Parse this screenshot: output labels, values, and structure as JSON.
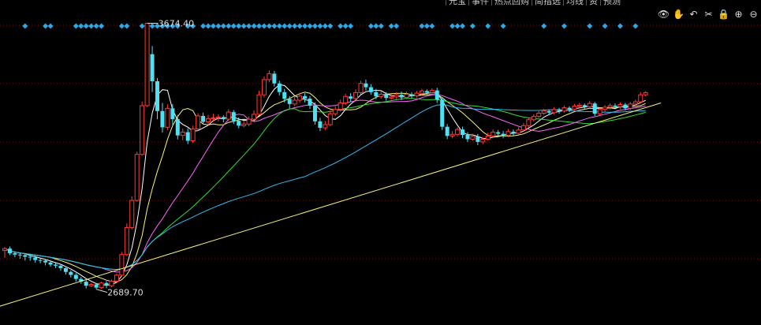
{
  "toolbar": {
    "tabs": [
      "元宝",
      "事件",
      "热点回购",
      "简指选",
      "均线",
      "资",
      "预测"
    ],
    "tools": [
      {
        "name": "eye-icon",
        "glyph": "👁"
      },
      {
        "name": "hand-icon",
        "glyph": "✋"
      },
      {
        "name": "undo-icon",
        "glyph": "↶"
      },
      {
        "name": "scissors-icon",
        "glyph": "✂"
      },
      {
        "name": "lock-icon",
        "glyph": "🔒"
      },
      {
        "name": "zoom-in-icon",
        "glyph": "⊕"
      },
      {
        "name": "zoom-out-icon",
        "glyph": "⊖"
      }
    ]
  },
  "chart_data": {
    "type": "candlestick",
    "ylim": [
      2560,
      3760
    ],
    "high_label": "3674.40",
    "low_label": "2689.70",
    "colors": {
      "up": "#ff3a3a",
      "down": "#4de1f5",
      "ma5": "#ffffff",
      "ma10": "#f5f57a",
      "ma20": "#ff66ff",
      "ma30": "#33dd33",
      "ma60": "#33bbee",
      "trend": "#f5f57a",
      "grid": "#7a1010",
      "marker": "#2aa9e8"
    },
    "candles": [
      [
        2835,
        2842,
        2808,
        2848
      ],
      [
        2842,
        2825,
        2818,
        2850
      ],
      [
        2825,
        2820,
        2810,
        2832
      ],
      [
        2820,
        2818,
        2805,
        2828
      ],
      [
        2818,
        2812,
        2798,
        2826
      ],
      [
        2812,
        2809,
        2797,
        2820
      ],
      [
        2809,
        2800,
        2790,
        2816
      ],
      [
        2800,
        2798,
        2788,
        2806
      ],
      [
        2798,
        2791,
        2780,
        2803
      ],
      [
        2791,
        2783,
        2775,
        2798
      ],
      [
        2783,
        2779,
        2770,
        2790
      ],
      [
        2779,
        2770,
        2760,
        2785
      ],
      [
        2770,
        2756,
        2746,
        2776
      ],
      [
        2756,
        2745,
        2735,
        2762
      ],
      [
        2745,
        2730,
        2720,
        2752
      ],
      [
        2730,
        2720,
        2712,
        2738
      ],
      [
        2720,
        2705,
        2695,
        2726
      ],
      [
        2705,
        2710,
        2700,
        2716
      ],
      [
        2710,
        2698,
        2692,
        2714
      ],
      [
        2698,
        2715,
        2693,
        2720
      ],
      [
        2715,
        2705,
        2696,
        2722
      ],
      [
        2705,
        2722,
        2700,
        2728
      ],
      [
        2722,
        2744,
        2715,
        2750
      ],
      [
        2744,
        2820,
        2740,
        2830
      ],
      [
        2820,
        2920,
        2815,
        2935
      ],
      [
        2920,
        3020,
        2912,
        3035
      ],
      [
        3020,
        3190,
        3015,
        3200
      ],
      [
        3190,
        3370,
        3185,
        3385
      ],
      [
        3370,
        3674,
        3365,
        3674
      ],
      [
        3560,
        3460,
        3420,
        3590
      ],
      [
        3460,
        3350,
        3320,
        3472
      ],
      [
        3350,
        3290,
        3270,
        3380
      ],
      [
        3290,
        3360,
        3280,
        3375
      ],
      [
        3360,
        3320,
        3300,
        3376
      ],
      [
        3320,
        3260,
        3245,
        3336
      ],
      [
        3260,
        3272,
        3242,
        3285
      ],
      [
        3272,
        3240,
        3228,
        3286
      ],
      [
        3240,
        3284,
        3232,
        3296
      ],
      [
        3284,
        3332,
        3278,
        3342
      ],
      [
        3332,
        3310,
        3300,
        3344
      ],
      [
        3310,
        3322,
        3298,
        3336
      ],
      [
        3322,
        3325,
        3310,
        3340
      ],
      [
        3325,
        3328,
        3312,
        3338
      ],
      [
        3328,
        3320,
        3308,
        3334
      ],
      [
        3320,
        3346,
        3314,
        3356
      ],
      [
        3346,
        3314,
        3302,
        3354
      ],
      [
        3314,
        3296,
        3286,
        3326
      ],
      [
        3296,
        3302,
        3290,
        3314
      ],
      [
        3302,
        3320,
        3294,
        3330
      ],
      [
        3320,
        3338,
        3314,
        3352
      ],
      [
        3338,
        3410,
        3334,
        3425
      ],
      [
        3410,
        3466,
        3400,
        3478
      ],
      [
        3466,
        3488,
        3456,
        3500
      ],
      [
        3488,
        3452,
        3440,
        3498
      ],
      [
        3452,
        3420,
        3408,
        3462
      ],
      [
        3420,
        3395,
        3382,
        3432
      ],
      [
        3395,
        3376,
        3360,
        3405
      ],
      [
        3376,
        3390,
        3368,
        3402
      ],
      [
        3390,
        3405,
        3380,
        3418
      ],
      [
        3405,
        3396,
        3382,
        3416
      ],
      [
        3396,
        3370,
        3358,
        3405
      ],
      [
        3370,
        3312,
        3300,
        3382
      ],
      [
        3312,
        3288,
        3276,
        3325
      ],
      [
        3288,
        3300,
        3280,
        3314
      ],
      [
        3300,
        3340,
        3294,
        3352
      ],
      [
        3340,
        3356,
        3332,
        3368
      ],
      [
        3356,
        3380,
        3348,
        3392
      ],
      [
        3380,
        3404,
        3372,
        3414
      ],
      [
        3404,
        3396,
        3384,
        3416
      ],
      [
        3396,
        3418,
        3390,
        3430
      ],
      [
        3418,
        3452,
        3412,
        3462
      ],
      [
        3452,
        3438,
        3426,
        3466
      ],
      [
        3438,
        3420,
        3410,
        3450
      ],
      [
        3420,
        3404,
        3394,
        3432
      ],
      [
        3404,
        3412,
        3396,
        3422
      ],
      [
        3412,
        3398,
        3388,
        3420
      ],
      [
        3398,
        3402,
        3392,
        3412
      ],
      [
        3402,
        3410,
        3394,
        3420
      ],
      [
        3410,
        3400,
        3390,
        3422
      ],
      [
        3400,
        3412,
        3394,
        3422
      ],
      [
        3412,
        3406,
        3396,
        3420
      ],
      [
        3406,
        3416,
        3400,
        3424
      ],
      [
        3416,
        3424,
        3408,
        3432
      ],
      [
        3424,
        3418,
        3408,
        3430
      ],
      [
        3418,
        3426,
        3410,
        3434
      ],
      [
        3426,
        3392,
        3380,
        3436
      ],
      [
        3392,
        3292,
        3280,
        3400
      ],
      [
        3292,
        3258,
        3246,
        3302
      ],
      [
        3258,
        3264,
        3250,
        3276
      ],
      [
        3264,
        3282,
        3256,
        3290
      ],
      [
        3282,
        3262,
        3250,
        3292
      ],
      [
        3262,
        3246,
        3236,
        3272
      ],
      [
        3246,
        3256,
        3240,
        3266
      ],
      [
        3256,
        3236,
        3224,
        3266
      ],
      [
        3236,
        3246,
        3228,
        3254
      ],
      [
        3246,
        3258,
        3240,
        3270
      ],
      [
        3258,
        3272,
        3250,
        3282
      ],
      [
        3272,
        3266,
        3256,
        3280
      ],
      [
        3266,
        3260,
        3250,
        3276
      ],
      [
        3260,
        3274,
        3254,
        3284
      ],
      [
        3274,
        3268,
        3258,
        3282
      ],
      [
        3268,
        3280,
        3262,
        3290
      ],
      [
        3280,
        3296,
        3274,
        3306
      ],
      [
        3296,
        3318,
        3290,
        3326
      ],
      [
        3318,
        3330,
        3312,
        3338
      ],
      [
        3330,
        3342,
        3324,
        3350
      ],
      [
        3342,
        3350,
        3336,
        3358
      ],
      [
        3350,
        3344,
        3334,
        3356
      ],
      [
        3344,
        3356,
        3338,
        3364
      ],
      [
        3356,
        3350,
        3340,
        3362
      ],
      [
        3350,
        3362,
        3344,
        3370
      ],
      [
        3362,
        3356,
        3346,
        3368
      ],
      [
        3356,
        3368,
        3350,
        3376
      ],
      [
        3368,
        3372,
        3360,
        3380
      ],
      [
        3372,
        3366,
        3356,
        3378
      ],
      [
        3366,
        3378,
        3360,
        3388
      ],
      [
        3378,
        3340,
        3332,
        3384
      ],
      [
        3340,
        3356,
        3334,
        3362
      ],
      [
        3356,
        3364,
        3346,
        3372
      ],
      [
        3364,
        3370,
        3356,
        3378
      ],
      [
        3370,
        3366,
        3356,
        3378
      ],
      [
        3366,
        3374,
        3358,
        3382
      ],
      [
        3374,
        3360,
        3352,
        3380
      ],
      [
        3360,
        3376,
        3354,
        3384
      ],
      [
        3376,
        3384,
        3370,
        3392
      ],
      [
        3384,
        3410,
        3378,
        3420
      ],
      [
        3410,
        3418,
        3404,
        3424
      ]
    ],
    "marker_columns": [
      4,
      8,
      9,
      14,
      15,
      16,
      17,
      18,
      19,
      23,
      24,
      27,
      28,
      29,
      30,
      31,
      32,
      33,
      34,
      36,
      37,
      39,
      40,
      41,
      42,
      43,
      44,
      45,
      46,
      47,
      48,
      49,
      50,
      51,
      52,
      53,
      54,
      55,
      56,
      57,
      58,
      59,
      60,
      61,
      62,
      63,
      64,
      66,
      67,
      68,
      72,
      73,
      74,
      76,
      77,
      82,
      83,
      84,
      88,
      89,
      90,
      92,
      95,
      98,
      106,
      110,
      115,
      118,
      121,
      124,
      127,
      131,
      135,
      141,
      145
    ]
  }
}
